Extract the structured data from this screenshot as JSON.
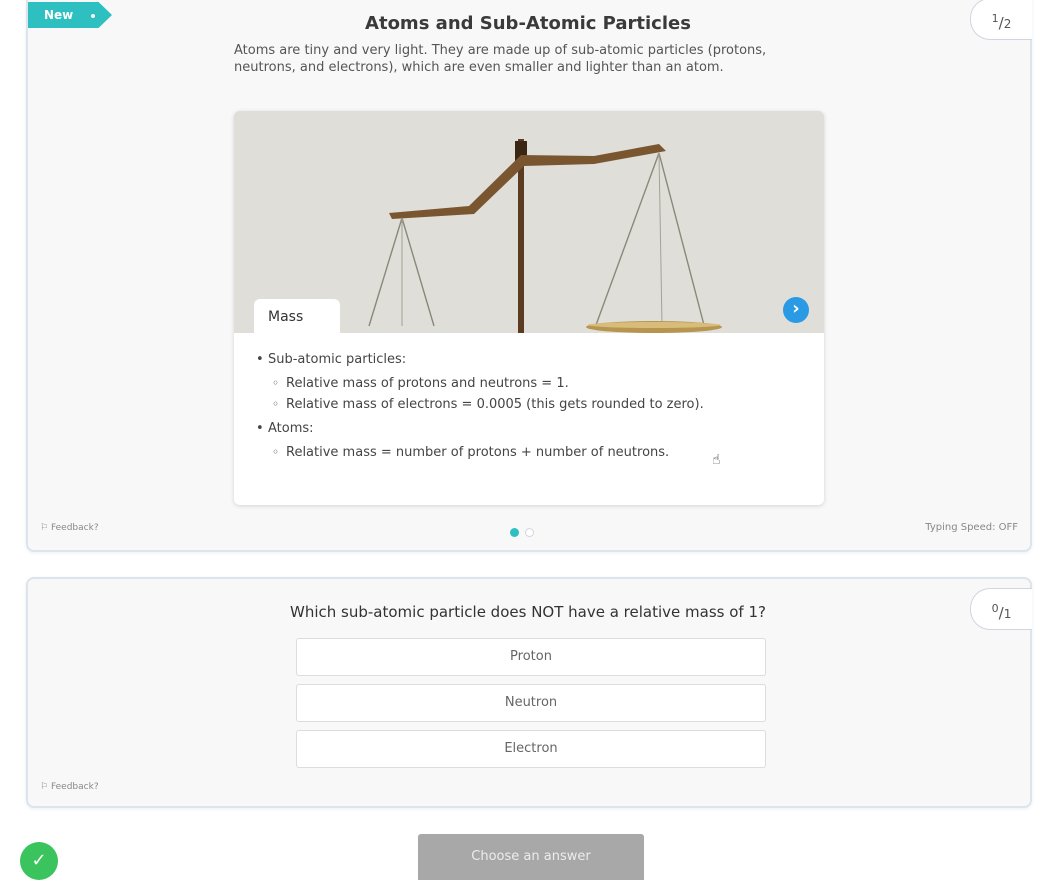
{
  "learn_card": {
    "badge": "New",
    "counter": {
      "current": "1",
      "total": "2"
    },
    "title": "Atoms and Sub-Atomic Particles",
    "intro": "Atoms are tiny and very light. They are made up of sub-atomic particles (protons, neutrons, and electrons), which are even smaller and lighter than an atom.",
    "slide": {
      "tab_label": "Mass",
      "bullets": [
        {
          "text": "Sub-atomic particles:",
          "sub": [
            "Relative mass of protons and neutrons = 1.",
            "Relative mass of electrons = 0.0005 (this gets rounded to zero)."
          ]
        },
        {
          "text": "Atoms:",
          "sub": [
            "Relative mass = number of protons + number of neutrons."
          ]
        }
      ]
    },
    "feedback": "Feedback?",
    "typing_speed": "Typing Speed: OFF",
    "pagination": {
      "current": 1,
      "total": 2
    }
  },
  "quiz_card": {
    "counter": {
      "current": "0",
      "total": "1"
    },
    "question": "Which sub-atomic particle does NOT have a relative mass of 1?",
    "answers": [
      "Proton",
      "Neutron",
      "Electron"
    ],
    "feedback": "Feedback?"
  },
  "footer": {
    "choose_button": "Choose an answer"
  },
  "icons": {
    "next": "chevron-right-icon",
    "check": "checkmark-icon",
    "feedback": "megaphone-icon"
  },
  "colors": {
    "accent": "#2ebfc1",
    "next_button": "#2a9ae4",
    "success": "#3bc45e",
    "disabled_button": "#a8a8a8"
  }
}
